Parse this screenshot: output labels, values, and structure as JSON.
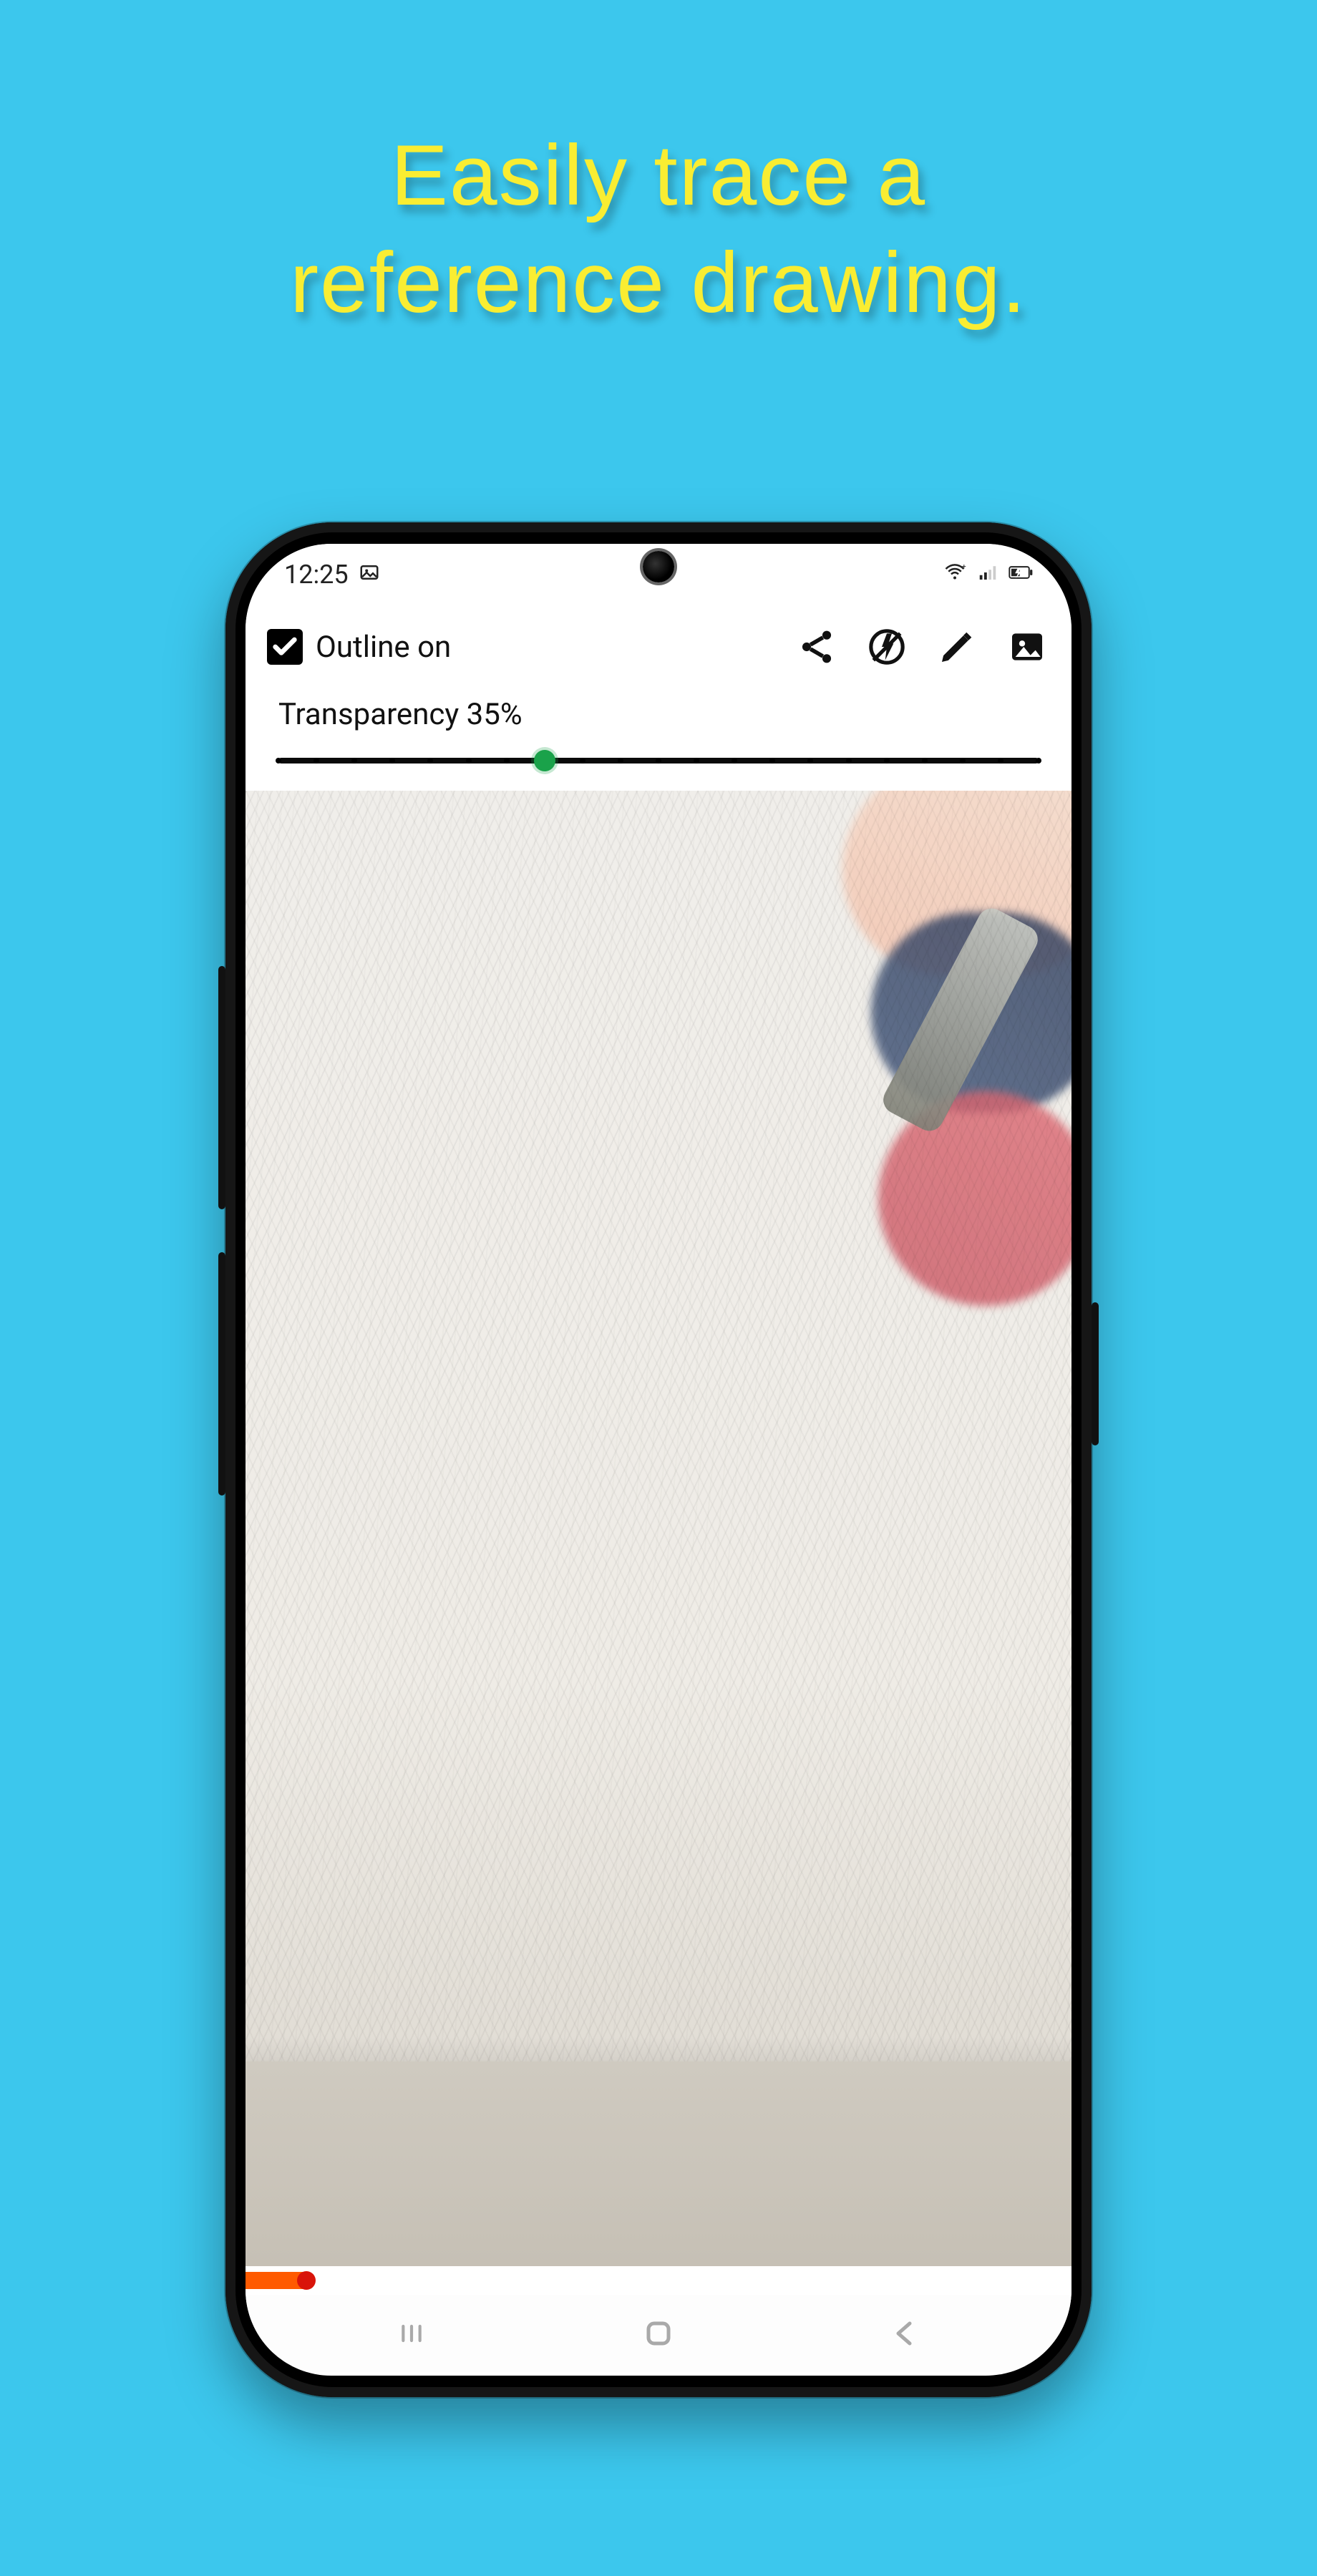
{
  "promo": {
    "line1": "Easily trace a",
    "line2": "reference drawing."
  },
  "statusbar": {
    "time": "12:25"
  },
  "toolbar": {
    "outline_label": "Outline on",
    "outline_checked": true
  },
  "transparency": {
    "label": "Transparency 35%",
    "value": 35,
    "min": 0,
    "max": 100,
    "step": 5
  },
  "record": {
    "progress_percent": 8
  }
}
